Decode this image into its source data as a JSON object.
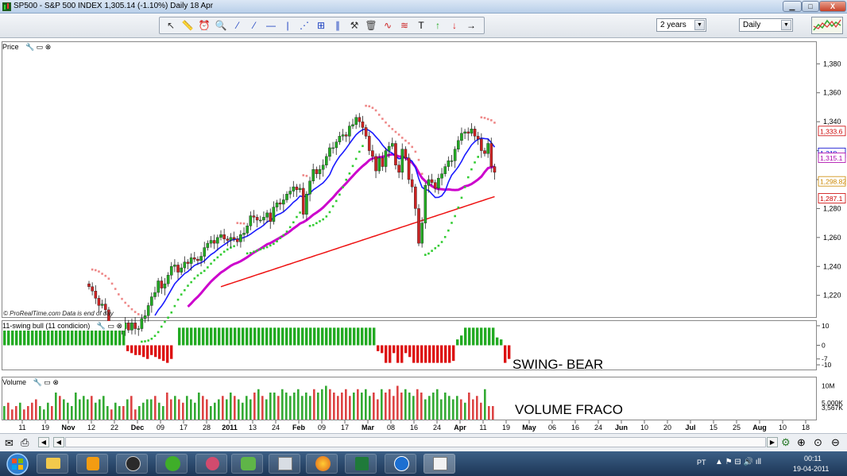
{
  "window": {
    "title": "SP500 - S&P 500 INDEX    1,305.14 (-1.10%)    Daily  18 Apr",
    "minimize_label": "▁",
    "maximize_label": "□",
    "close_label": "X"
  },
  "toolbar": {
    "period_select": "2 years",
    "interval_select": "Daily",
    "tools": [
      "cursor-icon",
      "ruler-icon",
      "alarm-icon",
      "zoom-icon",
      "line-icon",
      "segment-icon",
      "horizontal-line-icon",
      "vertical-line-icon",
      "fan-icon",
      "grid-icon",
      "parallel-icon",
      "hammer-icon",
      "trash-icon",
      "channel-icon",
      "fibonacci-icon",
      "text-icon",
      "arrow-up-icon",
      "arrow-down-icon",
      "arrow-right-icon"
    ]
  },
  "panels": {
    "price_label": "Price",
    "swing_label": "11-swing bull (11 condicion)",
    "volume_label": "Volume",
    "watermark": "© ProRealTime.com  Data is end of day",
    "swing_annotation": "SWING- BEAR",
    "volume_annotation": "VOLUME FRACO"
  },
  "chart_data": {
    "type": "candlestick",
    "title": "SP500 - S&P 500 INDEX",
    "ylim": [
      1205,
      1395
    ],
    "price_ticks": [
      "1,380",
      "1,360",
      "1,340",
      "1,320",
      "1,300",
      "1,280",
      "1,260",
      "1,240",
      "1,220"
    ],
    "price_tick_values": [
      1380,
      1360,
      1340,
      1320,
      1300,
      1280,
      1260,
      1240,
      1220
    ],
    "price_tags": [
      {
        "label": "1,333.6",
        "value": 1333.6,
        "color": "#cc0000"
      },
      {
        "label": "1,318",
        "value": 1318.5,
        "color": "#0000cc"
      },
      {
        "label": "1,315.1",
        "value": 1315.1,
        "color": "#aa00aa"
      },
      {
        "label": "1,298.82",
        "value": 1298.8,
        "color": "#cc8800"
      },
      {
        "label": "1,287.1",
        "value": 1287.1,
        "color": "#cc0000"
      }
    ],
    "swing_ticks": [
      "10",
      "0",
      "-7",
      "-10"
    ],
    "swing_tick_values": [
      10,
      0,
      -7,
      -10
    ],
    "swing_ylim": [
      -12,
      12
    ],
    "volume_ticks": [
      "10M",
      "5,000K",
      "3,567K"
    ],
    "x_labels": [
      "11",
      "19",
      "Nov",
      "12",
      "22",
      "Dec",
      "09",
      "17",
      "28",
      "2011",
      "13",
      "24",
      "Feb",
      "09",
      "17",
      "Mar",
      "08",
      "16",
      "24",
      "Apr",
      "11",
      "19",
      "May",
      "06",
      "16",
      "24",
      "Jun",
      "10",
      "20",
      "Jul",
      "15",
      "25",
      "Aug",
      "10",
      "18"
    ],
    "x_label_bold": [
      "Nov",
      "Dec",
      "2011",
      "Feb",
      "Mar",
      "Apr",
      "May",
      "Jun",
      "Jul",
      "Aug"
    ],
    "closes": [
      1226,
      1223,
      1218,
      1213,
      1214,
      1210,
      1199,
      1198,
      1197,
      1197,
      1197,
      1201,
      1196,
      1201,
      1197,
      1197,
      1204,
      1206,
      1213,
      1219,
      1222,
      1230,
      1225,
      1228,
      1234,
      1240,
      1241,
      1236,
      1239,
      1243,
      1242,
      1246,
      1245,
      1244,
      1247,
      1253,
      1256,
      1258,
      1256,
      1260,
      1262,
      1259,
      1258,
      1260,
      1259,
      1257,
      1262,
      1263,
      1268,
      1275,
      1274,
      1272,
      1272,
      1274,
      1277,
      1271,
      1281,
      1284,
      1283,
      1286,
      1290,
      1292,
      1295,
      1293,
      1294,
      1276,
      1290,
      1299,
      1307,
      1304,
      1307,
      1310,
      1316,
      1322,
      1322,
      1326,
      1330,
      1331,
      1330,
      1337,
      1338,
      1343,
      1340,
      1336,
      1330,
      1320,
      1316,
      1306,
      1315,
      1309,
      1320,
      1323,
      1325,
      1310,
      1305,
      1321,
      1315,
      1300,
      1295,
      1280,
      1256,
      1270,
      1296,
      1300,
      1298,
      1294,
      1301,
      1304,
      1309,
      1313,
      1313,
      1321,
      1327,
      1332,
      1333,
      1332,
      1335,
      1330,
      1328,
      1320,
      1318,
      1325,
      1309,
      1305
    ],
    "fast_ma_color": "#1a1aff",
    "mid_ma_color": "#cc00cc",
    "slow_ma_color": "#ee1111",
    "sar_up_color": "#33cc33",
    "sar_down_color": "#ee8888",
    "swing_values": [
      9,
      9,
      9,
      9,
      9,
      9,
      9,
      9,
      9,
      9,
      9,
      9,
      9,
      9,
      9,
      9,
      9,
      9,
      9,
      9,
      9,
      9,
      9,
      9,
      9,
      9,
      9,
      9,
      9,
      9,
      9,
      -3,
      -4,
      -5,
      -5,
      -6,
      -7,
      -5,
      -6,
      -7,
      -8,
      -9,
      -7,
      0,
      9,
      9,
      9,
      9,
      9,
      9,
      9,
      9,
      9,
      9,
      9,
      9,
      9,
      9,
      9,
      9,
      9,
      9,
      9,
      9,
      9,
      9,
      9,
      9,
      9,
      9,
      9,
      9,
      9,
      9,
      9,
      9,
      9,
      9,
      9,
      9,
      9,
      9,
      9,
      9,
      9,
      9,
      9,
      9,
      9,
      9,
      9,
      9,
      9,
      9,
      -3,
      -4,
      -9,
      -9,
      -4,
      -9,
      -9,
      -4,
      -6,
      -9,
      -9,
      -9,
      -9,
      -9,
      -9,
      -9,
      -9,
      -9,
      -9,
      -8,
      3,
      5,
      9,
      9,
      9,
      9,
      9,
      9,
      9,
      9,
      4,
      3,
      -9,
      -7
    ],
    "volume_values": [
      4,
      5,
      3,
      4,
      5,
      3,
      4,
      5,
      6,
      4,
      3,
      5,
      4,
      8,
      7,
      6,
      5,
      4,
      8,
      6,
      7,
      6,
      7,
      5,
      6,
      7,
      4,
      3,
      5,
      4,
      4,
      6,
      7,
      3,
      4,
      5,
      6,
      6,
      7,
      5,
      4,
      8,
      6,
      7,
      6,
      5,
      7,
      6,
      5,
      8,
      7,
      6,
      4,
      5,
      6,
      7,
      6,
      8,
      7,
      6,
      5,
      7,
      6,
      8,
      9,
      7,
      6,
      8,
      8,
      7,
      9,
      8,
      7,
      8,
      9,
      7,
      8,
      7,
      9,
      8,
      9,
      10,
      9,
      8,
      7,
      8,
      9,
      7,
      8,
      9,
      8,
      9,
      7,
      8,
      6,
      9,
      8,
      9,
      7,
      10,
      8,
      9,
      8,
      7,
      9,
      8,
      6,
      7,
      8,
      9,
      6,
      8,
      7,
      6,
      7,
      6,
      5,
      8,
      6,
      7,
      5,
      9,
      4,
      4
    ]
  },
  "statusbar": {
    "icons": [
      "mail-icon",
      "print-icon",
      "scroll-left-icon",
      "scroll-right-icon",
      "settings-icon",
      "zoom-in-icon",
      "zoom-fit-icon",
      "zoom-out-icon"
    ]
  },
  "taskbar": {
    "language": "PT",
    "time": "00:11",
    "date": "19-04-2011"
  }
}
